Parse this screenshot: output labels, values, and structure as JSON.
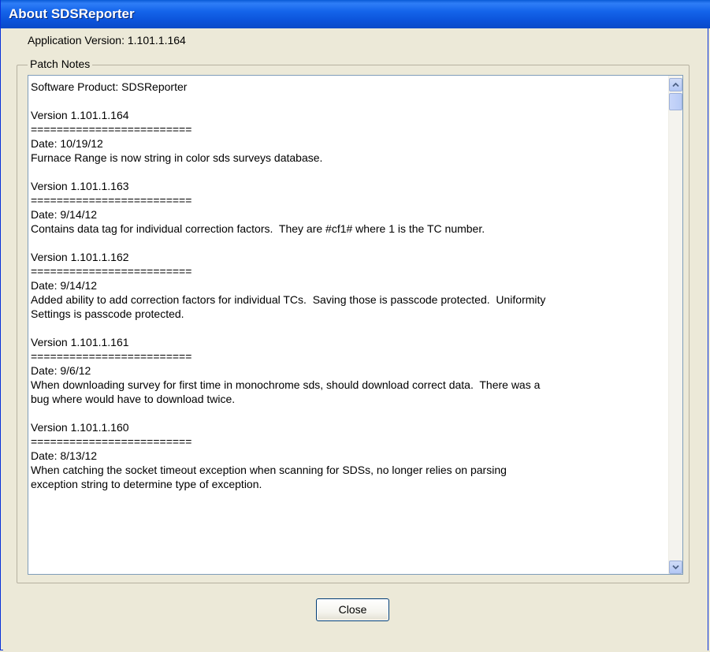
{
  "window": {
    "title": "About SDSReporter"
  },
  "app_version": "Application Version: 1.101.1.164",
  "patch_notes": {
    "legend": "Patch Notes",
    "text": "Software Product: SDSReporter\n\nVersion 1.101.1.164\n=========================\nDate: 10/19/12\nFurnace Range is now string in color sds surveys database.\n\nVersion 1.101.1.163\n=========================\nDate: 9/14/12\nContains data tag for individual correction factors.  They are #cf1# where 1 is the TC number.\n\nVersion 1.101.1.162\n=========================\nDate: 9/14/12\nAdded ability to add correction factors for individual TCs.  Saving those is passcode protected.  Uniformity\nSettings is passcode protected.\n\nVersion 1.101.1.161\n=========================\nDate: 9/6/12\nWhen downloading survey for first time in monochrome sds, should download correct data.  There was a\nbug where would have to download twice.\n\nVersion 1.101.1.160\n=========================\nDate: 8/13/12\nWhen catching the socket timeout exception when scanning for SDSs, no longer relies on parsing\nexception string to determine type of exception."
  },
  "buttons": {
    "close_label": "Close"
  },
  "icons": {
    "scroll_up": "chevron-up-icon",
    "scroll_down": "chevron-down-icon"
  }
}
